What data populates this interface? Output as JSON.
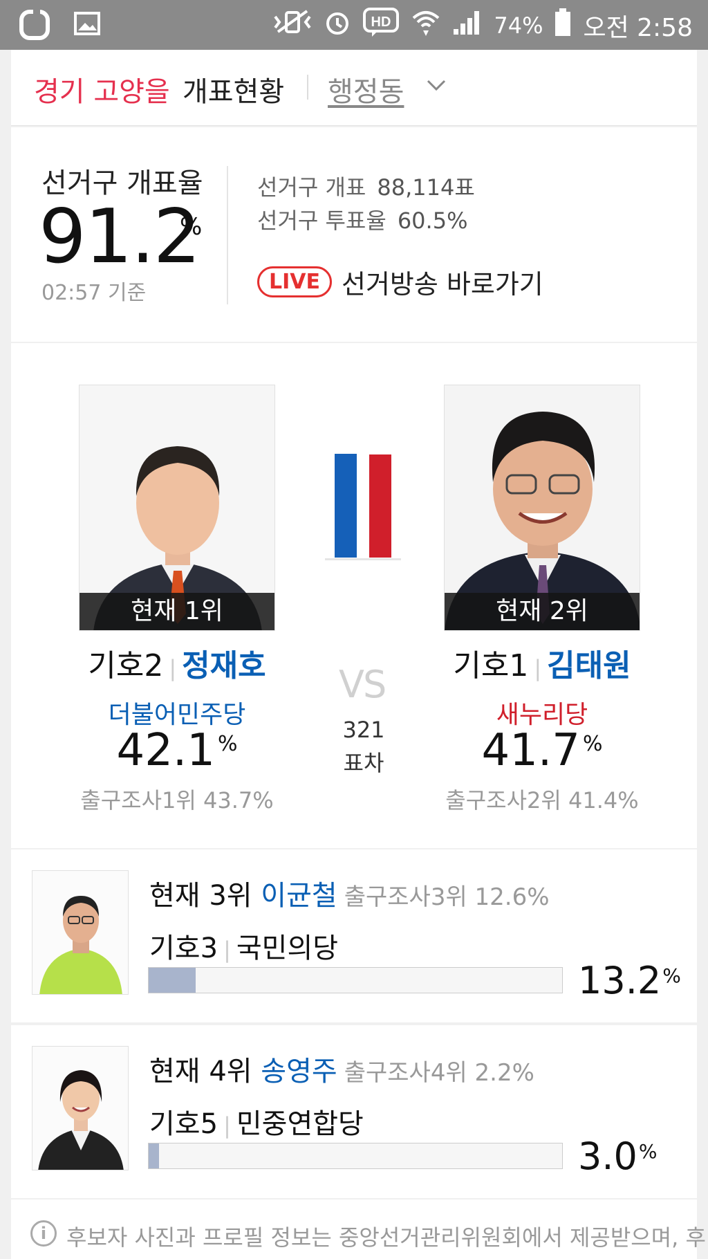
{
  "status_bar": {
    "battery": "74%",
    "time": "오전 2:58",
    "colors": {
      "background": "#8a8a8a"
    }
  },
  "header": {
    "region": "경기 고양을",
    "title": "개표현황",
    "district_label": "행정동"
  },
  "count": {
    "label": "선거구 개표율",
    "rate_value": "91.2",
    "rate_symbol": "%",
    "as_of": "02:57 기준",
    "votes_label": "선거구 개표",
    "votes_value": "88,114표",
    "turnout_label": "선거구 투표율",
    "turnout_value": "60.5%",
    "live_badge": "LIVE",
    "live_link": "선거방송 바로가기"
  },
  "race": {
    "leader": {
      "rank": "현재 1위",
      "number": "기호2",
      "name": "정재호",
      "party": "더불어민주당",
      "party_color": "#0a5fb4",
      "percent": "42.1",
      "pct_symbol": "%",
      "exit_poll": "출구조사1위 43.7%",
      "bar_share": 0.421,
      "bar_color": "#1560b8"
    },
    "runner_up": {
      "rank": "현재 2위",
      "number": "기호1",
      "name": "김태원",
      "party": "새누리당",
      "party_color": "#d01f2b",
      "percent": "41.7",
      "pct_symbol": "%",
      "exit_poll": "출구조사2위 41.4%",
      "bar_share": 0.417,
      "bar_color": "#d01f2b"
    },
    "vs": "VS",
    "margin_value": "321",
    "margin_label": "표차"
  },
  "others": [
    {
      "rank": "현재 3위",
      "name": "이균철",
      "exit_poll": "출구조사3위 12.6%",
      "number": "기호3",
      "party": "국민의당",
      "percent": "13.2",
      "pct_symbol": "%",
      "share": 0.132
    },
    {
      "rank": "현재 4위",
      "name": "송영주",
      "exit_poll": "출구조사4위 2.2%",
      "number": "기호5",
      "party": "민중연합당",
      "percent": "3.0",
      "pct_symbol": "%",
      "share": 0.03
    }
  ],
  "notice": {
    "text": "후보자 사진과 프로필 정보는 중앙선거관리위원회에서 제공받으며, 후"
  }
}
